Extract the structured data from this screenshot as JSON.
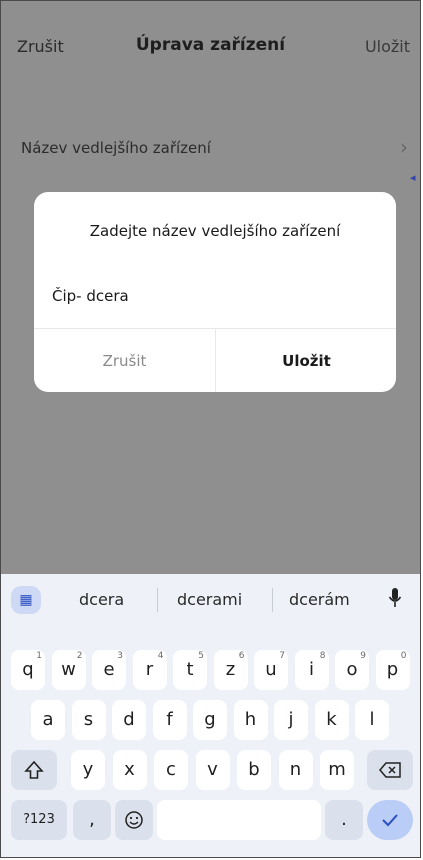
{
  "header": {
    "cancel_label": "Zrušit",
    "title": "Úprava zařízení",
    "save_label": "Uložit"
  },
  "list": {
    "row_label": "Název vedlejšího zařízení",
    "chevron": "›"
  },
  "dialog": {
    "title": "Zadejte název vedlejšího zařízení",
    "input_value": "Čip- dcera",
    "cancel_label": "Zrušit",
    "save_label": "Uložit"
  },
  "keyboard": {
    "suggestions": [
      "dcera",
      "dcerami",
      "dcerám"
    ],
    "row1": [
      {
        "k": "q",
        "s": "1"
      },
      {
        "k": "w",
        "s": "2"
      },
      {
        "k": "e",
        "s": "3"
      },
      {
        "k": "r",
        "s": "4"
      },
      {
        "k": "t",
        "s": "5"
      },
      {
        "k": "z",
        "s": "6"
      },
      {
        "k": "u",
        "s": "7"
      },
      {
        "k": "i",
        "s": "8"
      },
      {
        "k": "o",
        "s": "9"
      },
      {
        "k": "p",
        "s": "0"
      }
    ],
    "row2": [
      "a",
      "s",
      "d",
      "f",
      "g",
      "h",
      "j",
      "k",
      "l"
    ],
    "row3": [
      "y",
      "x",
      "c",
      "v",
      "b",
      "n",
      "m"
    ],
    "symbols_label": "?123",
    "comma": ",",
    "period": "."
  },
  "colors": {
    "accent": "#2a4fbf",
    "overlay": "#8f8f8f"
  }
}
